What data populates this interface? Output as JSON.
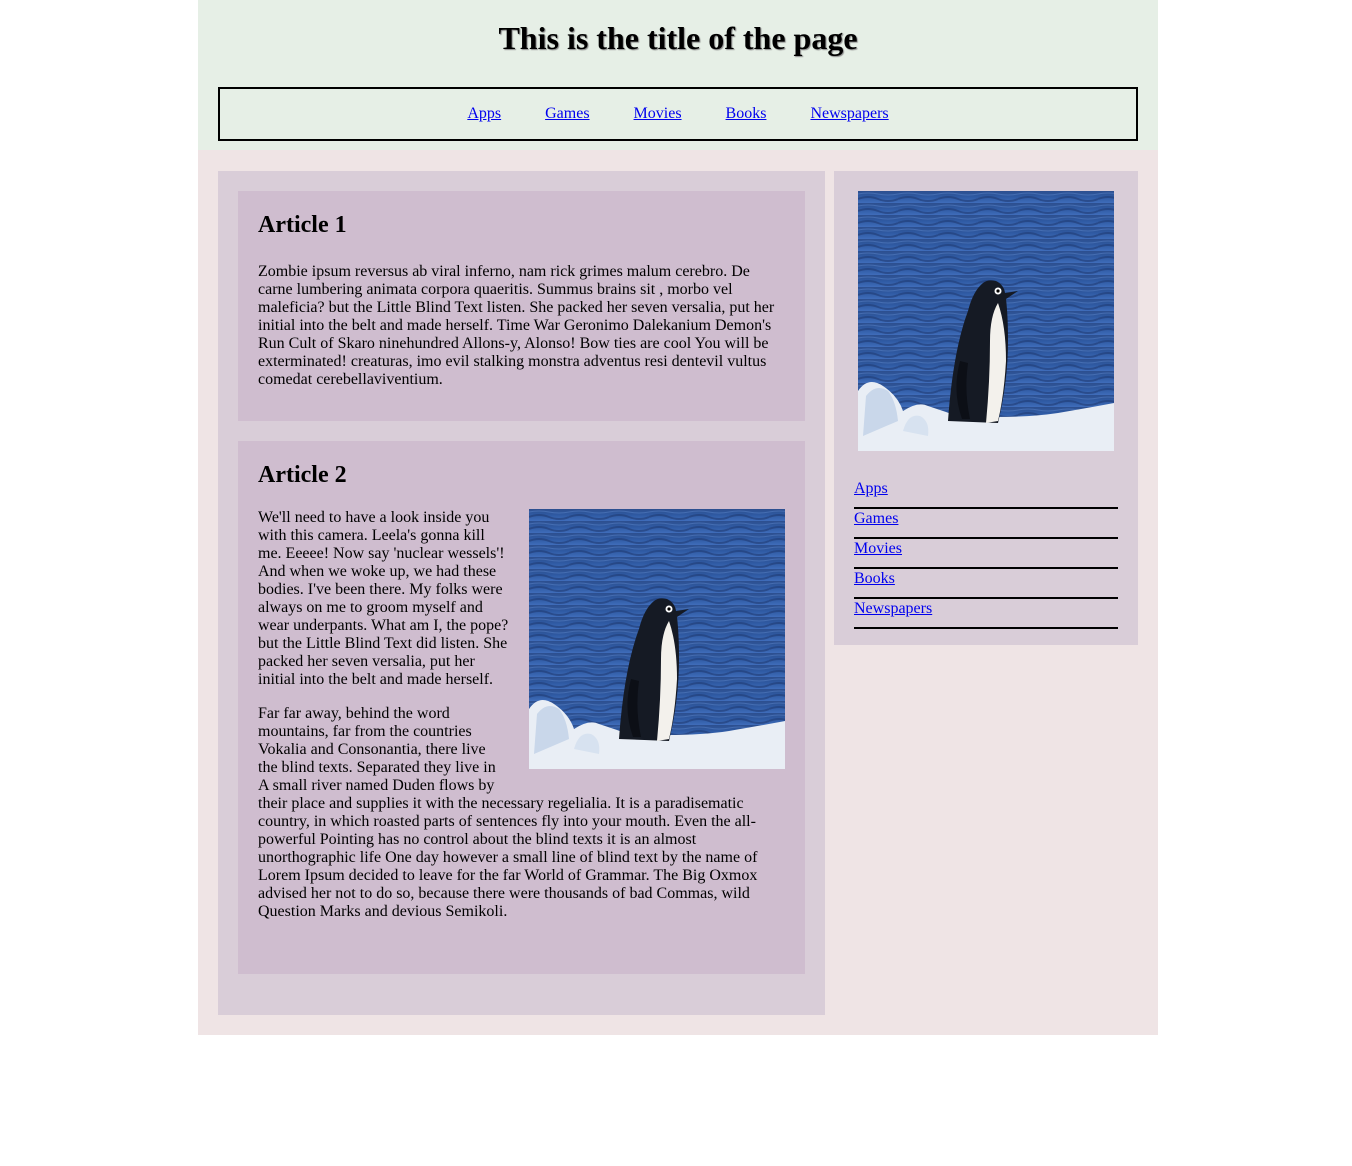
{
  "header": {
    "title": "This is the title of the page",
    "nav": [
      "Apps",
      "Games",
      "Movies",
      "Books",
      "Newspapers"
    ]
  },
  "articles": [
    {
      "heading": "Article 1",
      "paragraphs": [
        "Zombie ipsum reversus ab viral inferno, nam rick grimes malum cerebro. De carne lumbering animata corpora quaeritis. Summus brains sit , morbo vel maleficia? but the Little Blind Text listen. She packed her seven versalia, put her initial into the belt and made herself. Time War Geronimo Dalekanium Demon's Run Cult of Skaro ninehundred Allons-y, Alonso! Bow ties are cool You will be exterminated! creaturas, imo evil stalking monstra adventus resi dentevil vultus comedat cerebellaviventium."
      ]
    },
    {
      "heading": "Article 2",
      "image": "penguin-photo",
      "paragraphs": [
        "We'll need to have a look inside you with this camera. Leela's gonna kill me. Eeeee! Now say 'nuclear wessels'! And when we woke up, we had these bodies. I've been there. My folks were always on me to groom myself and wear underpants. What am I, the pope? but the Little Blind Text did listen. She packed her seven versalia, put her initial into the belt and made herself.",
        "Far far away, behind the word mountains, far from the countries Vokalia and Consonantia, there live the blind texts. Separated they live in A small river named Duden flows by their place and supplies it with the necessary regelialia. It is a paradisematic country, in which roasted parts of sentences fly into your mouth. Even the all-powerful Pointing has no control about the blind texts it is an almost unorthographic life One day however a small line of blind text by the name of Lorem Ipsum decided to leave for the far World of Grammar. The Big Oxmox advised her not to do so, because there were thousands of bad Commas, wild Question Marks and devious Semikoli."
      ]
    }
  ],
  "sidebar": {
    "image": "penguin-photo",
    "nav": [
      "Apps",
      "Games",
      "Movies",
      "Books",
      "Newspapers"
    ]
  },
  "colors": {
    "header_bg": "#e6efe6",
    "main_bg": "#efe4e5",
    "column_bg": "#d9cdd8",
    "article_bg": "#cfbdcf",
    "link": "#0000ee"
  }
}
